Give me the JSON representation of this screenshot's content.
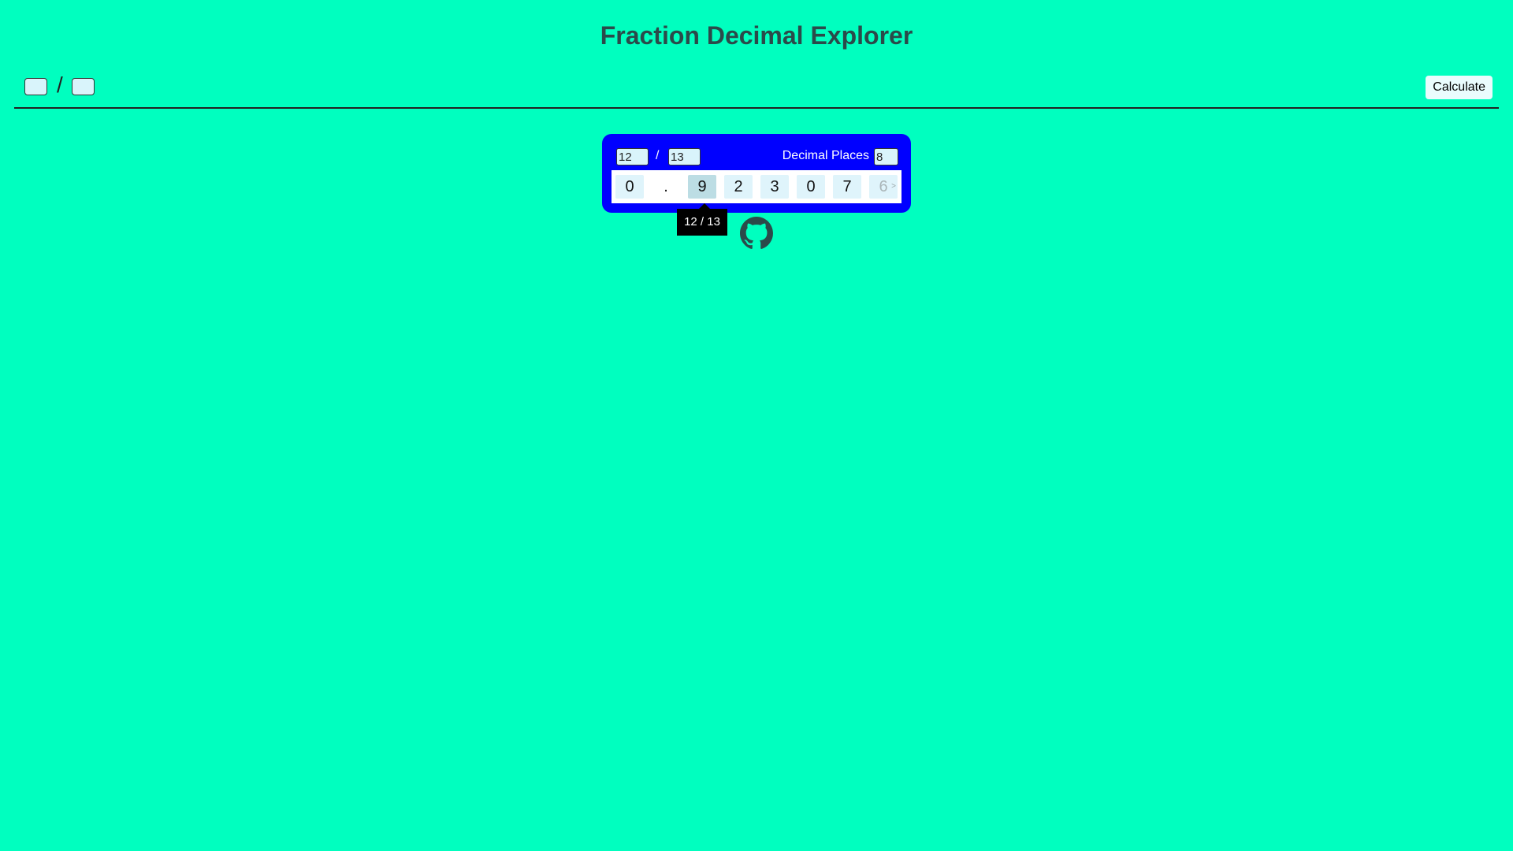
{
  "header": {
    "title": "Fraction Decimal Explorer"
  },
  "toolbar": {
    "numerator_value": "",
    "slash": "/",
    "denominator_value": "",
    "calculate_label": "Calculate"
  },
  "card": {
    "numerator_value": "12",
    "slash": "/",
    "denominator_value": "13",
    "places_label": "Decimal Places",
    "places_value": "8",
    "digits": [
      "0",
      ".",
      "9",
      "2",
      "3",
      "0",
      "7",
      "6"
    ],
    "more_indicator": ">",
    "active_digit": "9"
  },
  "tooltip": {
    "text": "12 / 13"
  },
  "footer": {
    "github_icon": "github-icon"
  },
  "colors": {
    "background": "#00ffbf",
    "card": "#0000ff",
    "title": "#2b4a4a"
  }
}
